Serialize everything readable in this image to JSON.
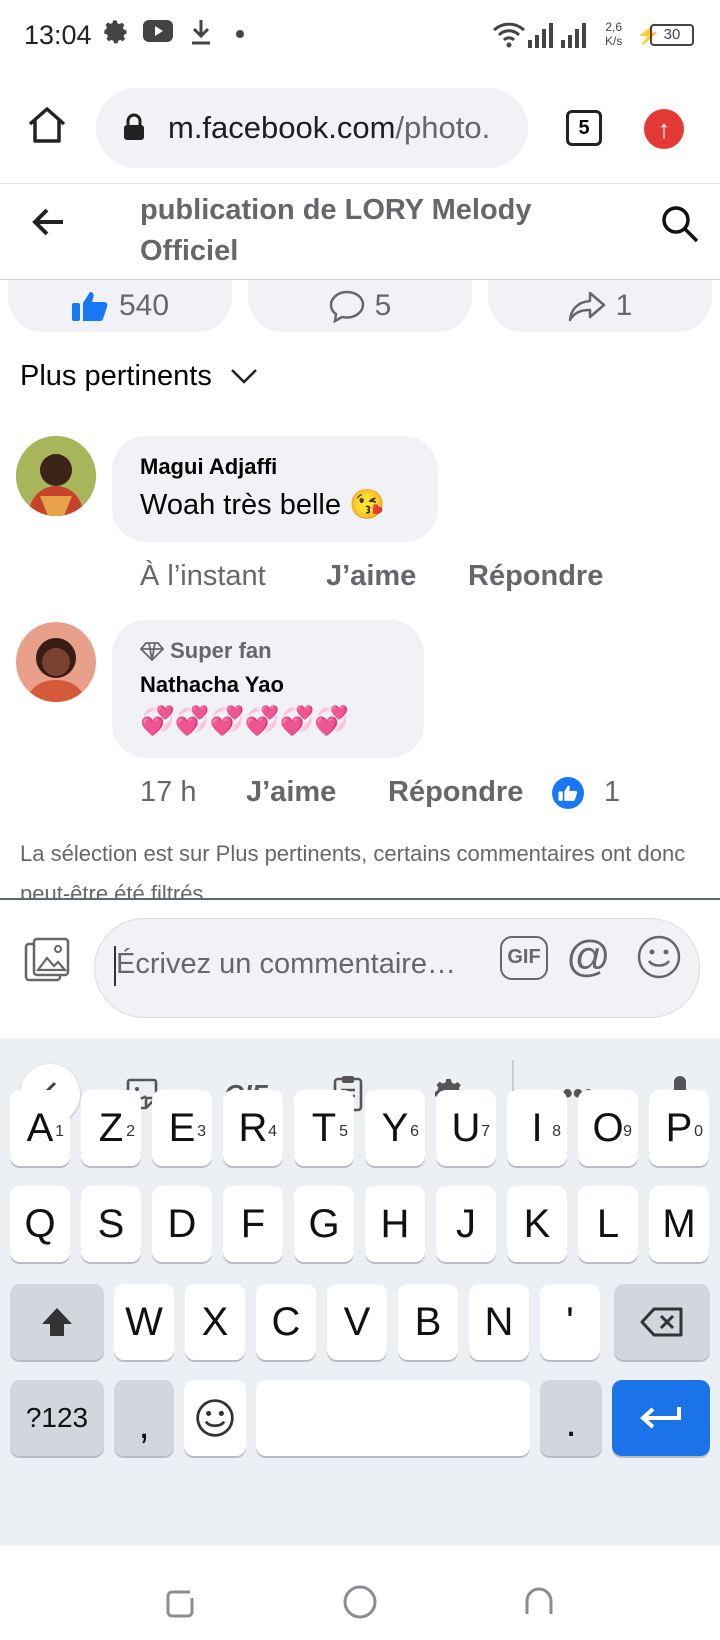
{
  "status_bar": {
    "time": "13:04",
    "network_speed_value": "2,6",
    "network_speed_unit": "K/s",
    "battery": "30"
  },
  "browser": {
    "url_domain": "m.facebook.com",
    "url_path": "/photo.",
    "tab_count": "5"
  },
  "header": {
    "title": "publication de LORY Melody Officiel"
  },
  "reactions": {
    "likes": "540",
    "comments": "5",
    "shares": "1"
  },
  "sort": {
    "label": "Plus pertinents"
  },
  "comments": [
    {
      "author": "Magui Adjaffi",
      "text": "Woah très belle 😘",
      "time": "À l’instant",
      "like_label": "J’aime",
      "reply_label": "Répondre"
    },
    {
      "badge": "Super fan",
      "author": "Nathacha Yao",
      "text": "💞💞💞💞💞💞",
      "time": "17 h",
      "like_label": "J’aime",
      "reply_label": "Répondre",
      "reaction_count": "1"
    }
  ],
  "notice": "La sélection est sur Plus pertinents, certains commentaires ont donc peut-être été filtrés.",
  "composer": {
    "placeholder": "Écrivez un commentaire…",
    "gif_label": "GIF"
  },
  "keyboard": {
    "toolbar_gif": "GIF",
    "row1": [
      {
        "k": "A",
        "n": "1"
      },
      {
        "k": "Z",
        "n": "2"
      },
      {
        "k": "E",
        "n": "3"
      },
      {
        "k": "R",
        "n": "4"
      },
      {
        "k": "T",
        "n": "5"
      },
      {
        "k": "Y",
        "n": "6"
      },
      {
        "k": "U",
        "n": "7"
      },
      {
        "k": "I",
        "n": "8"
      },
      {
        "k": "O",
        "n": "9"
      },
      {
        "k": "P",
        "n": "0"
      }
    ],
    "row2": [
      "Q",
      "S",
      "D",
      "F",
      "G",
      "H",
      "J",
      "K",
      "L",
      "M"
    ],
    "row3": [
      "W",
      "X",
      "C",
      "V",
      "B",
      "N",
      "'"
    ],
    "symbols_label": "?123",
    "comma": ",",
    "period": "."
  },
  "colors": {
    "facebook_blue": "#1877f2",
    "text_secondary": "#65676b",
    "bubble_bg": "#f0f2f5",
    "enter_key": "#1a73e8"
  }
}
